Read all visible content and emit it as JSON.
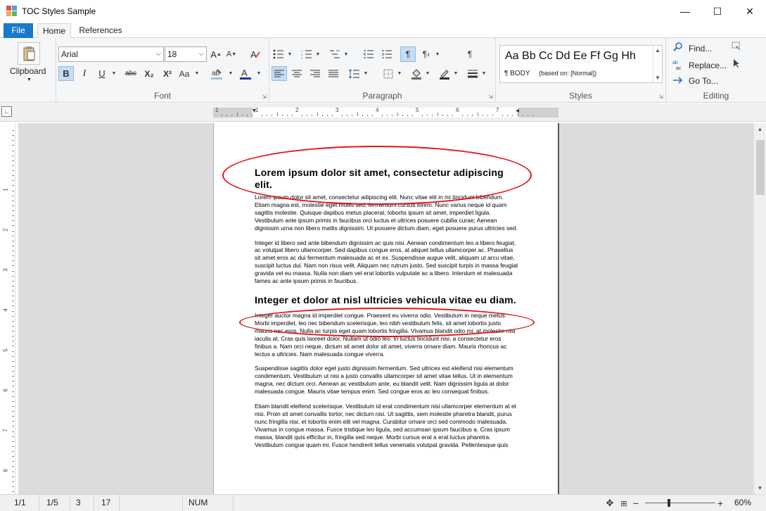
{
  "window": {
    "title": "TOC Styles Sample",
    "minimize": "—",
    "maximize": "☐",
    "close": "✕"
  },
  "tabs": {
    "file": "File",
    "home": "Home",
    "references": "References"
  },
  "clipboard": {
    "label": "Clipboard"
  },
  "font": {
    "group_label": "Font",
    "family": "Arial",
    "size": "18",
    "bold": "B",
    "italic": "I",
    "underline": "U",
    "strike": "abc",
    "subscript": "X₂",
    "superscript": "X²",
    "change_case": "Aa",
    "grow": "A",
    "shrink": "A",
    "font_color": "A"
  },
  "paragraph": {
    "group_label": "Paragraph"
  },
  "styles": {
    "group_label": "Styles",
    "sample": "Aa Bb Cc Dd Ee Ff Gg Hh",
    "current": "¶ BODY",
    "based_on": "(based on: [Normal])"
  },
  "editing": {
    "group_label": "Editing",
    "find": "Find...",
    "replace": "Replace...",
    "goto": "Go To..."
  },
  "ruler": {
    "h_numbers": [
      "1",
      "1",
      "2",
      "3",
      "4",
      "5",
      "6",
      "7"
    ],
    "v_numbers": [
      "1",
      "2",
      "3",
      "4",
      "5",
      "6",
      "7",
      "8"
    ]
  },
  "document": {
    "heading1": "Lorem ipsum dolor sit amet, consectetur adipiscing elit.",
    "p1": "Lorem ipsum dolor sit amet, consectetur adipiscing elit. Nunc vitae elit in mi tincidunt bibendum. Etiam magna est, molestie eget mollis sed, fermentum cursus lorem. Nunc varius neque id quam sagittis molestie. Quisque dapibus metus placerat, lobortis ipsum sit amet, imperdiet ligula. Vestibulum ante ipsum primis in faucibus orci luctus et ultrices posuere cubilia curae; Aenean dignissim urna non libero mattis dignissim. Ut posuere dictum diam, eget posuere purus ultricies sed.",
    "p2": "Integer id libero sed ante bibendum dignissim ac quis nisi. Aenean condimentum leo a libero feugiat, ac volutpat libero ullamcorper. Sed dapibus congue eros, at aliquet tellus ullamcorper ac. Phasellus sit amet eros ac dui fermentum malesuada ac et ex. Suspendisse augue velit, aliquam ut arcu vitae, suscipit luctus dui. Nam non risus velit. Aliquam nec rutrum justo. Sed suscipit turpis in massa feugiat gravida vel eu massa. Nulla non diam vel erat lobortis vulputate ac a libero. Interdum et malesuada fames ac ante ipsum primis in faucibus.",
    "heading2": "Integer et dolor at nisl ultricies vehicula vitae eu diam.",
    "p3": "Integer auctor magna id imperdiet congue. Praesent eu viverra odio. Vestibulum in neque metus. Morbi imperdiet, leo nec bibendum scelerisque, leo nibh vestibulum felis, sit amet lobortis justo mauris nec eros. Nulla ac turpis eget quam lobortis fringilla. Vivamus blandit odio mi, at molestie nisl iaculis at. Cras quis laoreet dolor. Nullam ut odio leo. In luctus tincidunt nisi, a consectetur eros finibus a. Nam orci neque, dictum sit amet dolor sit amet, viverra ornare diam. Mauris rhoncus ac lectus a ultricies. Nam malesuada congue viverra.",
    "p4": "Suspendisse sagittis dolor eget justo dignissim fermentum. Sed ultrices est eleifend nisi elementum condimentum. Vestibulum ut nisi a justo convallis ullamcorper sit amet vitae tellus. Ut in elementum magna, nec dictum orci. Aenean ac vestibulum ante, eu blandit velit. Nam dignissim ligula at dolor malesuada congue. Mauris vitae tempus enim. Sed congue eros ac leo consequat finibus.",
    "p5": "Etiam blandit eleifend scelerisque. Vestibulum id erat condimentum nisi ullamcorper elementum at et nisi. Proin sit amet convallis tortor, nec dictum nisi. Ut sagittis, sem molestie pharetra blandit, purus nunc fringilla nisi, et lobortis enim elit vel magna. Curabitur ornare orci sed commodo malesuada. Vivamus in congue massa. Fusce tristique leo ligula, sed accumsan ipsum faucibus a. Cras ipsum massa, blandit quis efficitur in, fringilla sed neque. Morbi cursus erat a erat luctus pharetra. Vestibulum congue quam mi. Fusce hendrerit tellus venenatis volutpat gravida. Pellentesque quis"
  },
  "status": {
    "page": "1/1",
    "section": "1/5",
    "line": "3",
    "col": "17",
    "num": "NUM",
    "zoom": "60%",
    "zoom_fraction": 0.34
  },
  "colors": {
    "accent": "#1979ca",
    "highlight_oval": "#e31414"
  }
}
